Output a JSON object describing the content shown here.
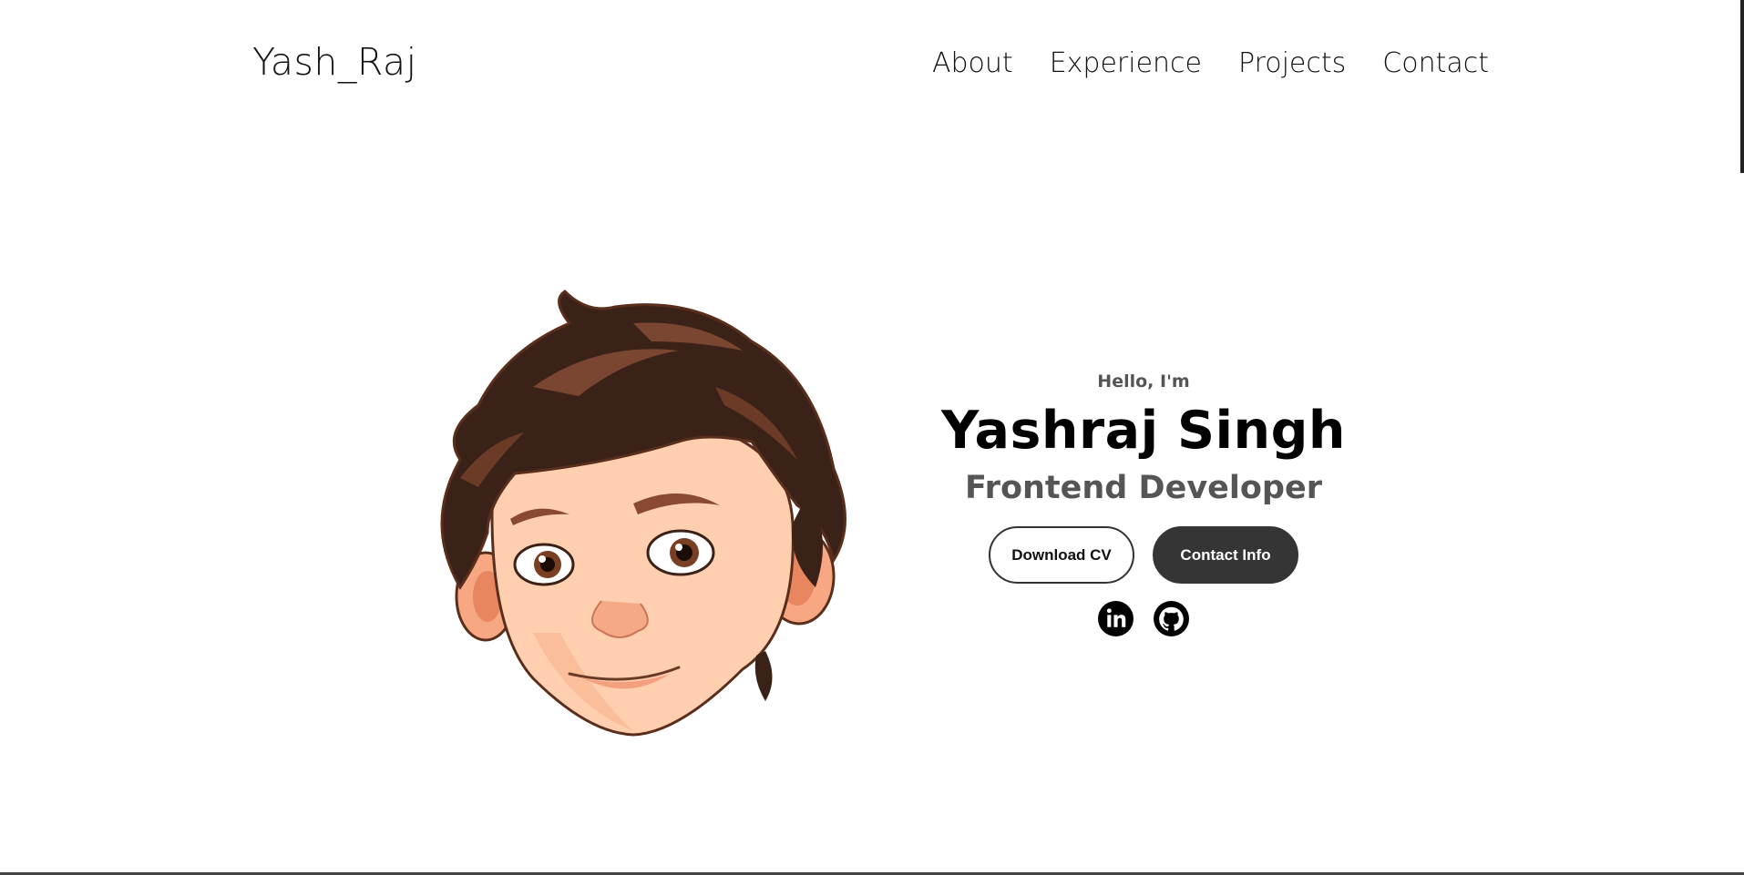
{
  "nav": {
    "logo": "Yash_Raj",
    "links": [
      {
        "label": "About"
      },
      {
        "label": "Experience"
      },
      {
        "label": "Projects"
      },
      {
        "label": "Contact"
      }
    ]
  },
  "hero": {
    "greeting": "Hello, I'm",
    "name": "Yashraj Singh",
    "role": "Frontend Developer",
    "avatar_alt": "cartoon-boy-avatar",
    "buttons": {
      "download": "Download CV",
      "contact": "Contact Info"
    },
    "socials": [
      {
        "icon": "linkedin-icon"
      },
      {
        "icon": "github-icon"
      }
    ]
  },
  "colors": {
    "text": "#111111",
    "muted": "#555555",
    "button_dark": "#353535",
    "hair": "#3a2218",
    "skin": "#ffc9a8"
  }
}
